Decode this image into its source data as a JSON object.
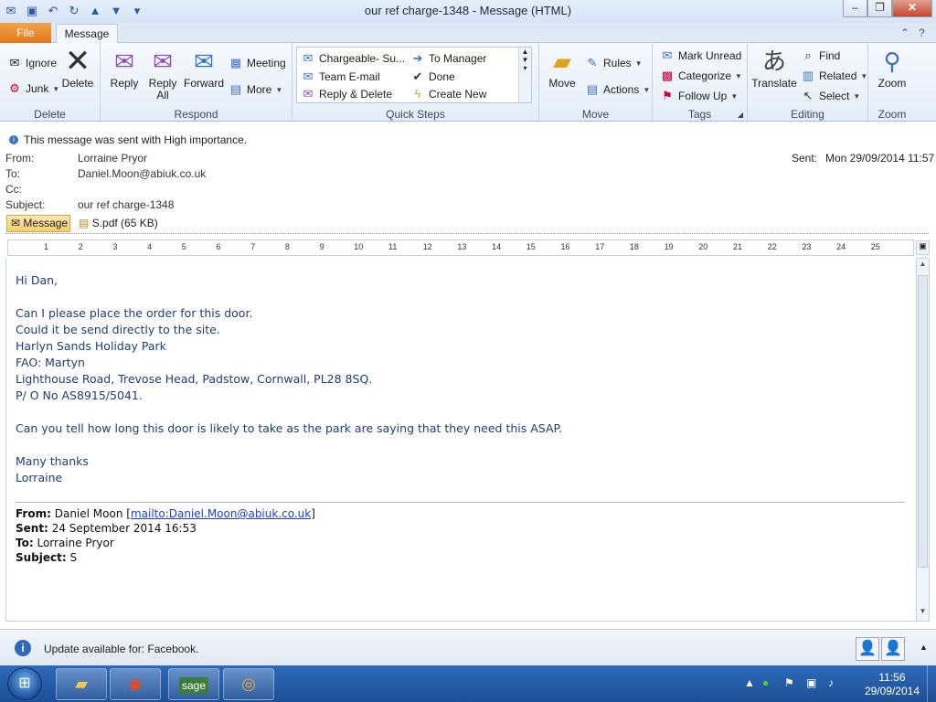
{
  "window": {
    "title": "our ref charge-1348  -  Message (HTML)",
    "minimize": "–",
    "maximize": "❐",
    "close": "✕"
  },
  "tabs": {
    "file": "File",
    "message": "Message"
  },
  "ribbon": {
    "delete_group": {
      "label": "Delete",
      "ignore": "Ignore",
      "junk": "Junk",
      "delete": "Delete"
    },
    "respond_group": {
      "label": "Respond",
      "reply": "Reply",
      "reply_all_1": "Reply",
      "reply_all_2": "All",
      "forward": "Forward",
      "meeting": "Meeting",
      "more": "More"
    },
    "quick_steps": {
      "label": "Quick Steps",
      "items": [
        "Chargeable- Su...",
        "To Manager",
        "Team E-mail",
        "Done",
        "Reply & Delete",
        "Create New"
      ]
    },
    "move_group": {
      "label": "Move",
      "move": "Move",
      "rules": "Rules",
      "actions": "Actions"
    },
    "tags_group": {
      "label": "Tags",
      "mark_unread": "Mark Unread",
      "categorize": "Categorize",
      "follow_up": "Follow Up"
    },
    "editing_group": {
      "label": "Editing",
      "translate": "Translate",
      "find": "Find",
      "related": "Related",
      "select": "Select"
    },
    "zoom_group": {
      "label": "Zoom",
      "zoom": "Zoom"
    }
  },
  "message": {
    "importance": "This message was sent with High importance.",
    "from_label": "From:",
    "from": "Lorraine Pryor",
    "to_label": "To:",
    "to": "Daniel.Moon@abiuk.co.uk",
    "cc_label": "Cc:",
    "cc": "",
    "subject_label": "Subject:",
    "subject": "our ref charge-1348",
    "sent_label": "Sent:",
    "sent": "Mon 29/09/2014 11:57",
    "message_tab": "Message",
    "attachment": "S.pdf (65 KB)"
  },
  "ruler": [
    "1",
    "2",
    "3",
    "4",
    "5",
    "6",
    "7",
    "8",
    "9",
    "10",
    "11",
    "12",
    "13",
    "14",
    "15",
    "16",
    "17",
    "18",
    "19",
    "20",
    "21",
    "22",
    "23",
    "24",
    "25"
  ],
  "body": {
    "lines": [
      "Hi Dan,",
      "Can I please place the order for this door.",
      "Could it be send directly to the site.",
      "Harlyn Sands Holiday Park",
      "FAO: Martyn",
      "Lighthouse Road, Trevose Head, Padstow, Cornwall, PL28 8SQ.",
      "P/ O No AS8915/5041.",
      "Can you tell how long this door is likely to take as the park are saying that they need this ASAP.",
      "Many thanks",
      "Lorraine"
    ]
  },
  "quoted": {
    "from_label": "From:",
    "from_name": "Daniel Moon",
    "from_link": "mailto:Daniel.Moon@abiuk.co.uk",
    "sent_label": "Sent:",
    "sent": "24 September 2014 16:53",
    "to_label": "To:",
    "to": "Lorraine Pryor",
    "subject_label": "Subject:",
    "subject": "S"
  },
  "people_pane": {
    "update_text": "Update available for: Facebook."
  },
  "taskbar": {
    "time": "11:56",
    "date": "29/09/2014",
    "sage": "sage"
  }
}
